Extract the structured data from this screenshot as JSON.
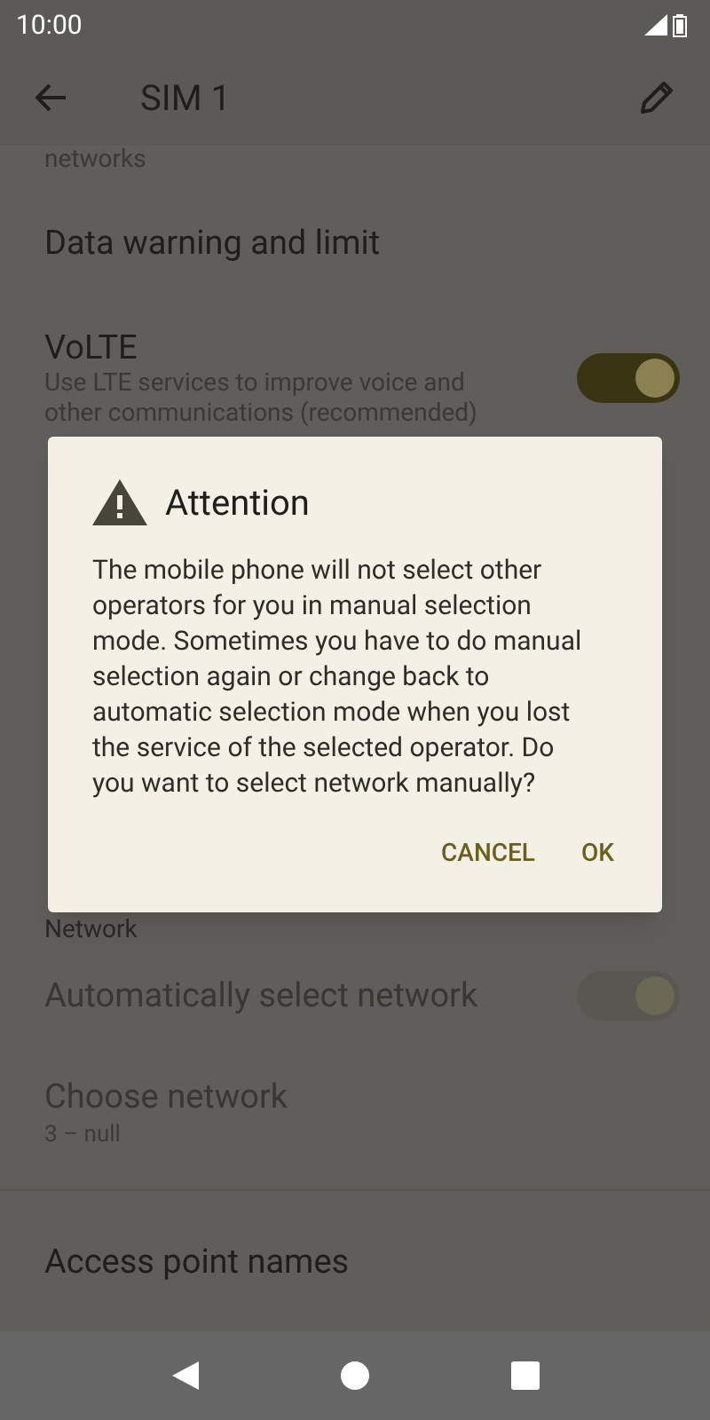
{
  "status_bar": {
    "time": "10:00"
  },
  "app_bar": {
    "title": "SIM 1"
  },
  "items": [
    {
      "kind": "clipped",
      "title": "networks"
    },
    {
      "kind": "plain",
      "title": "Data warning and limit",
      "disabled": false
    },
    {
      "kind": "switch",
      "title": "VoLTE",
      "subtitle": "Use LTE services to improve voice and other communications (recommended)",
      "on": true,
      "disabled": false
    },
    {
      "kind": "gap"
    },
    {
      "kind": "header",
      "title": "Network"
    },
    {
      "kind": "switch",
      "title": "Automatically select network",
      "on": true,
      "disabled": true
    },
    {
      "kind": "plain",
      "title": "Choose network",
      "subtitle": "3 – null",
      "disabled": true
    },
    {
      "kind": "divider"
    },
    {
      "kind": "plain",
      "title": "Access point names",
      "disabled": false
    }
  ],
  "dialog": {
    "title": "Attention",
    "message": "The mobile phone will not select other operators for you in manual selection mode. Sometimes you have to do manual selection again or change back to automatic selection mode when you lost the service of the selected operator. Do you want to select network manually?",
    "buttons": [
      "CANCEL",
      "OK"
    ]
  }
}
